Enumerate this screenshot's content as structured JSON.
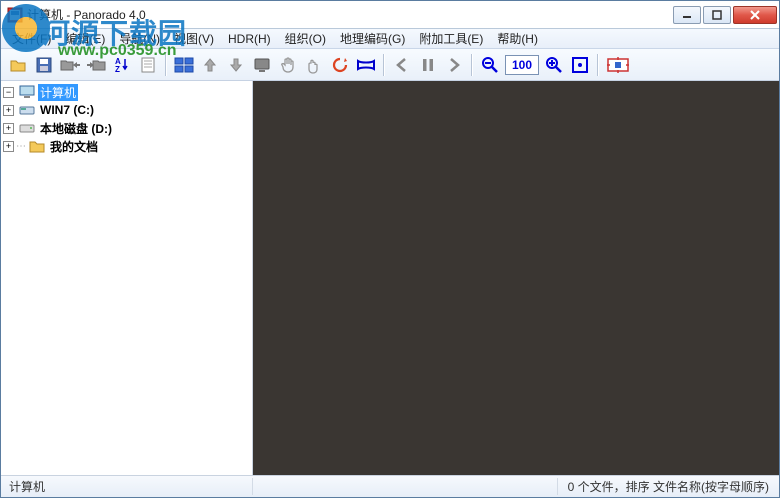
{
  "window": {
    "title": "计算机 - Panorado 4.0"
  },
  "watermark": {
    "brand": "河源下载园",
    "url": "www.pc0359.cn"
  },
  "menu": {
    "file": "文件(F)",
    "edit": "编辑(E)",
    "nav": "导航(N)",
    "view": "视图(V)",
    "hdr": "HDR(H)",
    "organize": "组织(O)",
    "geocode": "地理编码(G)",
    "extras": "附加工具(E)",
    "help": "帮助(H)"
  },
  "toolbar": {
    "zoom_value": "100"
  },
  "tree": {
    "root": "计算机",
    "drives": {
      "win7": "WIN7 (C:)",
      "local": "本地磁盘 (D:)"
    },
    "mydocs": "我的文档"
  },
  "status": {
    "path": "计算机",
    "info": "0 个文件，排序 文件名称(按字母顺序)"
  }
}
